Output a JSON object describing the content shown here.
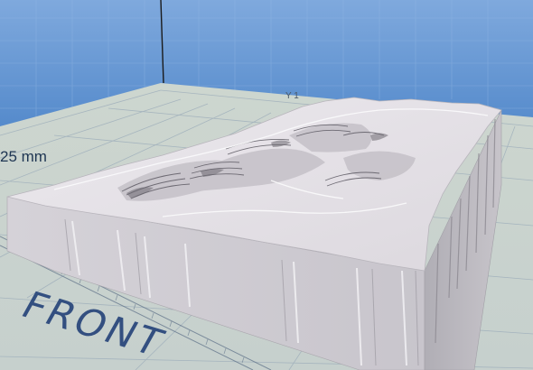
{
  "viewport": {
    "dimension_label": "25 mm",
    "axis_label": "Y 1",
    "bed_label": "FRONT"
  },
  "colors": {
    "backdrop_blue": "#5d8fcd",
    "grid_line": "#8fa3b8",
    "bed_surface": "#c9d4cf",
    "model_grey": "#ddd9de",
    "wall_shadow": "#bcbac0"
  },
  "icons": {
    "model": "terrain-model-icon",
    "bed": "print-bed-grid"
  }
}
